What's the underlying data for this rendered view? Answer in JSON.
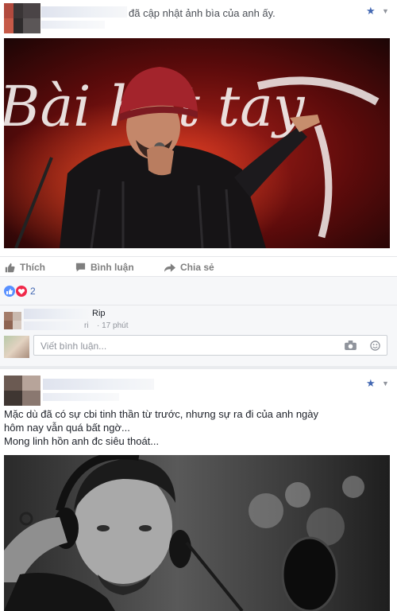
{
  "post1": {
    "header_text": "đã cập nhật ảnh bìa của anh ấy.",
    "photo_caption": "Bài hát tay",
    "actions": {
      "like": "Thích",
      "comment": "Bình luận",
      "share": "Chia sẻ"
    },
    "reaction_count": "2",
    "comment": {
      "text": "Rip",
      "meta": "· 17 phút",
      "name_suffix": "ri"
    },
    "comment_placeholder": "Viết bình luận..."
  },
  "post2": {
    "body_lines": [
      "Mặc dù đã có sự cbi tinh thần từ trước, nhưng sự ra đi của anh ngày",
      "hôm nay vẫn quá bất ngờ...",
      "Mong linh hồn anh đc siêu thoát..."
    ]
  },
  "icons": {
    "star": "star-icon",
    "chevron": "chevron-down-icon",
    "like": "thumbs-up-icon",
    "comment": "comment-icon",
    "share": "share-arrow-icon",
    "camera": "camera-icon",
    "emoji": "emoji-icon"
  },
  "colors": {
    "facebook_blue": "#4267b2",
    "like_blue": "#5890ff",
    "love_red": "#f0284a",
    "stage_red": "#8b0f0f"
  }
}
